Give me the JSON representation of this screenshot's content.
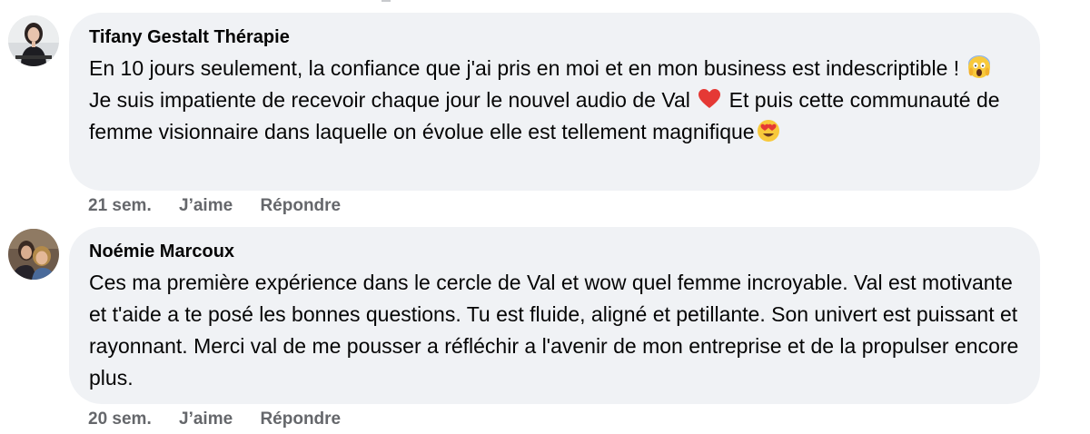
{
  "comments": [
    {
      "author": "Tifany Gestalt Thérapie",
      "text_parts": [
        "En 10 jours seulement, la confiance que j'ai pris en moi et en mon business est indescriptible ! ",
        " Je suis impatiente de recevoir chaque jour le nouvel audio de Val ",
        " Et puis cette communauté de femme visionnaire dans laquelle on évolue elle est tellement magnifique"
      ],
      "emojis": [
        "screaming-face-emoji",
        "red-heart-emoji",
        "heart-eyes-emoji"
      ],
      "time": "21 sem.",
      "like_label": "J’aime",
      "reply_label": "Répondre"
    },
    {
      "author": "Noémie Marcoux",
      "text": "Ces ma première expérience dans le cercle de Val et wow quel femme incroyable. Val est motivante et t'aide a te posé les bonnes questions. Tu est fluide, aligné et petillante. Son univert est puissant et rayonnant. Merci val de me pousser a réfléchir a l'avenir de mon entreprise et de la propulser encore plus.",
      "time": "20 sem.",
      "like_label": "J’aime",
      "reply_label": "Répondre"
    }
  ],
  "colors": {
    "bubble": "#f0f2f5",
    "meta_text": "#65676b",
    "text": "#050505"
  }
}
